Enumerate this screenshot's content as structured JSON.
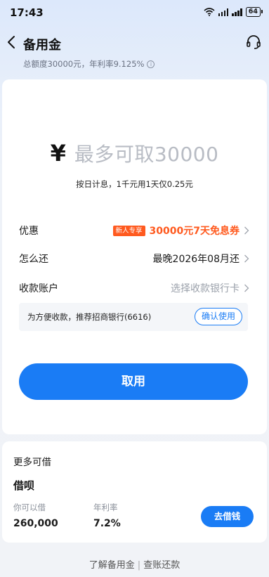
{
  "status_bar": {
    "time": "17:43",
    "battery": "64"
  },
  "nav": {
    "title": "备用金",
    "subtitle": "总额度30000元，年利率9.125%"
  },
  "amount": {
    "currency_symbol": "¥",
    "placeholder": "最多可取30000",
    "daily_note": "按日计息，1千元用1天仅0.25元"
  },
  "rows": {
    "discount": {
      "label": "优惠",
      "badge": "新人专享",
      "value": "30000元7天免息券"
    },
    "repay": {
      "label": "怎么还",
      "value": "最晚2026年08月还"
    },
    "account": {
      "label": "收款账户",
      "value": "选择收款银行卡"
    }
  },
  "recommend": {
    "text": "为方便收款，推荐招商银行(6616)",
    "button": "确认使用"
  },
  "withdraw_button": "取用",
  "more": {
    "title": "更多可借",
    "product": "借呗",
    "available_label": "你可以借",
    "available_value": "260,000",
    "rate_label": "年利率",
    "rate_value": "7.2%",
    "button": "去借钱"
  },
  "footer": {
    "learn": "了解备用金",
    "separator": "|",
    "bills": "查账还款"
  },
  "colors": {
    "accent": "#1a7cf5",
    "promo": "#ff5a1f"
  }
}
